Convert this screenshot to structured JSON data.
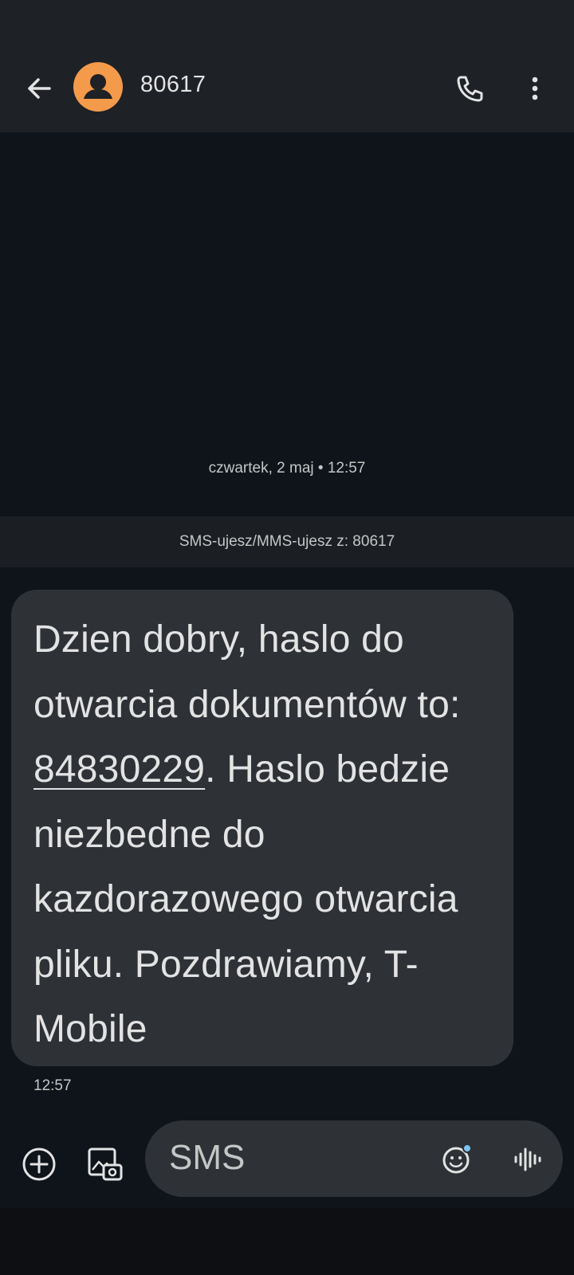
{
  "header": {
    "contact_name": "80617",
    "icons": {
      "back": "arrow-left-icon",
      "avatar": "person-icon",
      "call": "phone-icon",
      "more": "more-vert-icon"
    }
  },
  "thread": {
    "date_separator": "czwartek, 2 maj • 12:57",
    "sender_info": "SMS-ujesz/MMS-ujesz z: 80617",
    "message": {
      "text_before": "Dzien dobry, haslo do otwarcia dokumentów to: ",
      "link": "84830229",
      "text_after": ". Haslo bedzie niezbedne do kazdorazowego otwarcia pliku. Pozdrawiamy, T-Mobile",
      "time": "12:57"
    }
  },
  "composer": {
    "placeholder": "SMS",
    "icons": {
      "add": "add-circle-icon",
      "gallery": "gallery-icon",
      "emoji": "emoji-icon",
      "voice": "voice-wave-icon"
    }
  },
  "colors": {
    "background": "#0f141b",
    "bar": "#1e2125",
    "bubble": "#2e3136",
    "avatar": "#f49a4b",
    "accent_dot": "#7cc4f8"
  }
}
